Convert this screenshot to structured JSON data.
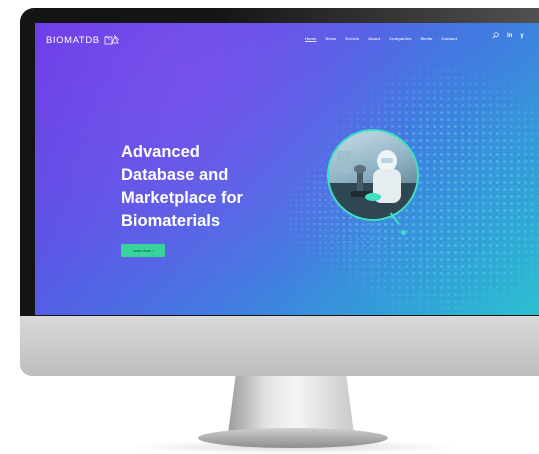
{
  "brand": {
    "name": "BIOMATDB",
    "logo_icon": "biomatdb-logo-icon"
  },
  "nav": {
    "items": [
      "Home",
      "News",
      "Events",
      "About",
      "Companies",
      "Media",
      "Contact"
    ],
    "active": "Home",
    "search_icon": "search-icon",
    "social": [
      {
        "label": "in",
        "icon": "linkedin-icon"
      },
      {
        "label": "y",
        "icon": "twitter-icon"
      }
    ]
  },
  "hero": {
    "title_lines": [
      "Advanced",
      "Database and",
      "Marketplace for",
      "Biomaterials"
    ],
    "button_label": "Learn more ›",
    "image_icon": "lab-researcher-photo"
  },
  "colors": {
    "gradient_start": "#6a39e6",
    "gradient_end": "#2cc3cf",
    "button": "#37d39a",
    "accent_ring": "#3fe0c2"
  }
}
